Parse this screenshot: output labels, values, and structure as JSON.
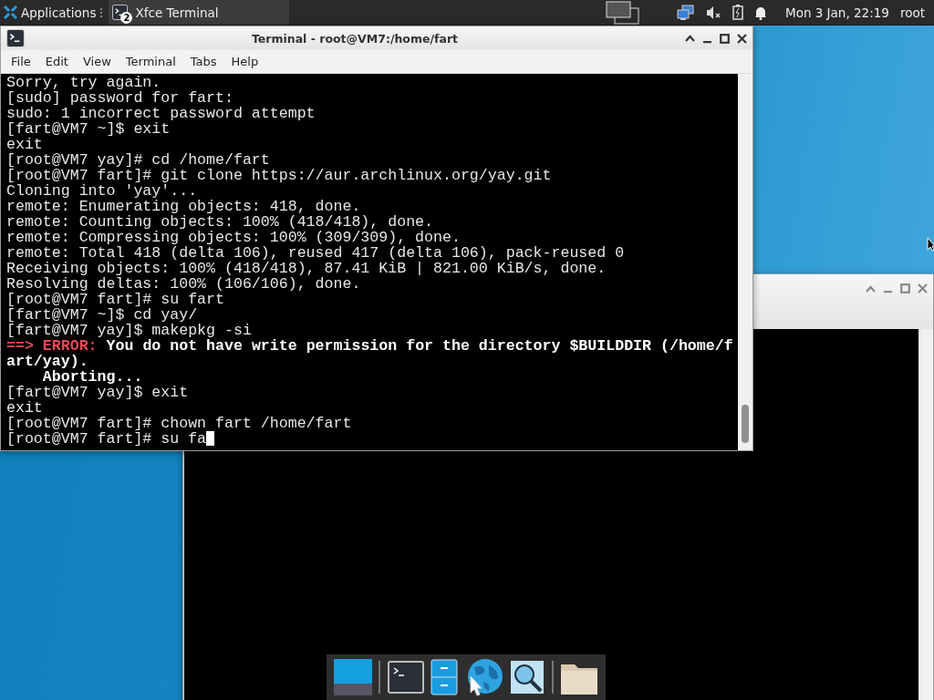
{
  "panel": {
    "menu_label": "Applications",
    "tasks": [
      {
        "label": "Xfce Terminal",
        "badge": "2",
        "selected": true
      }
    ],
    "clock": "Mon 3 Jan, 22:19",
    "user": "root"
  },
  "terminal_window": {
    "title": "Terminal - root@VM7:/home/fart",
    "menu": [
      "File",
      "Edit",
      "View",
      "Terminal",
      "Tabs",
      "Help"
    ],
    "lines": [
      {
        "kind": "plain",
        "text": "Sorry, try again."
      },
      {
        "kind": "plain",
        "text": "[sudo] password for fart:"
      },
      {
        "kind": "plain",
        "text": "sudo: 1 incorrect password attempt"
      },
      {
        "kind": "plain",
        "text": "[fart@VM7 ~]$ exit"
      },
      {
        "kind": "plain",
        "text": "exit"
      },
      {
        "kind": "plain",
        "text": "[root@VM7 yay]# cd /home/fart"
      },
      {
        "kind": "plain",
        "text": "[root@VM7 fart]# git clone https://aur.archlinux.org/yay.git"
      },
      {
        "kind": "plain",
        "text": "Cloning into 'yay'..."
      },
      {
        "kind": "plain",
        "text": "remote: Enumerating objects: 418, done."
      },
      {
        "kind": "plain",
        "text": "remote: Counting objects: 100% (418/418), done."
      },
      {
        "kind": "plain",
        "text": "remote: Compressing objects: 100% (309/309), done."
      },
      {
        "kind": "plain",
        "text": "remote: Total 418 (delta 106), reused 417 (delta 106), pack-reused 0"
      },
      {
        "kind": "plain",
        "text": "Receiving objects: 100% (418/418), 87.41 KiB | 821.00 KiB/s, done."
      },
      {
        "kind": "plain",
        "text": "Resolving deltas: 100% (106/106), done."
      },
      {
        "kind": "plain",
        "text": "[root@VM7 fart]# su fart"
      },
      {
        "kind": "plain",
        "text": "[fart@VM7 ~]$ cd yay/"
      },
      {
        "kind": "plain",
        "text": "[fart@VM7 yay]$ makepkg -si"
      },
      {
        "kind": "error",
        "prefix": "==> ERROR:",
        "text": "You do not have write permission for the directory $BUILDDIR (/home/f"
      },
      {
        "kind": "bold",
        "text": "art/yay)."
      },
      {
        "kind": "bold",
        "text": "    Aborting..."
      },
      {
        "kind": "plain",
        "text": "[fart@VM7 yay]$ exit"
      },
      {
        "kind": "plain",
        "text": "exit"
      },
      {
        "kind": "plain",
        "text": "[root@VM7 fart]# chown fart /home/fart"
      },
      {
        "kind": "input",
        "text": "[root@VM7 fart]# su fa"
      }
    ]
  }
}
